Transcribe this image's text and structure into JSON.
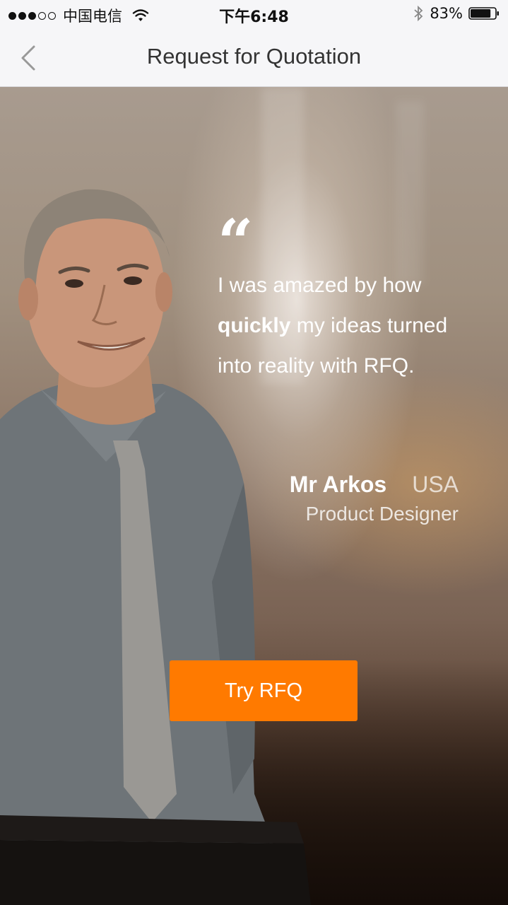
{
  "status_bar": {
    "carrier": "中国电信",
    "time": "下午6:48",
    "battery_percent": "83%",
    "battery_level": 0.83,
    "signal_bars_on": 3,
    "signal_bars_total": 5
  },
  "nav": {
    "title": "Request for Quotation",
    "back_icon": "chevron-left-icon"
  },
  "testimonial": {
    "quote_mark": "“",
    "quote_line_1": "I was amazed by how",
    "quote_emphasis": "quickly",
    "quote_line_2_rest": " my ideas turned",
    "quote_line_3": "into reality with RFQ.",
    "author_name": "Mr Arkos",
    "author_country": "USA",
    "author_role": "Product Designer"
  },
  "cta": {
    "label": "Try RFQ",
    "color": "#ff7a00"
  }
}
